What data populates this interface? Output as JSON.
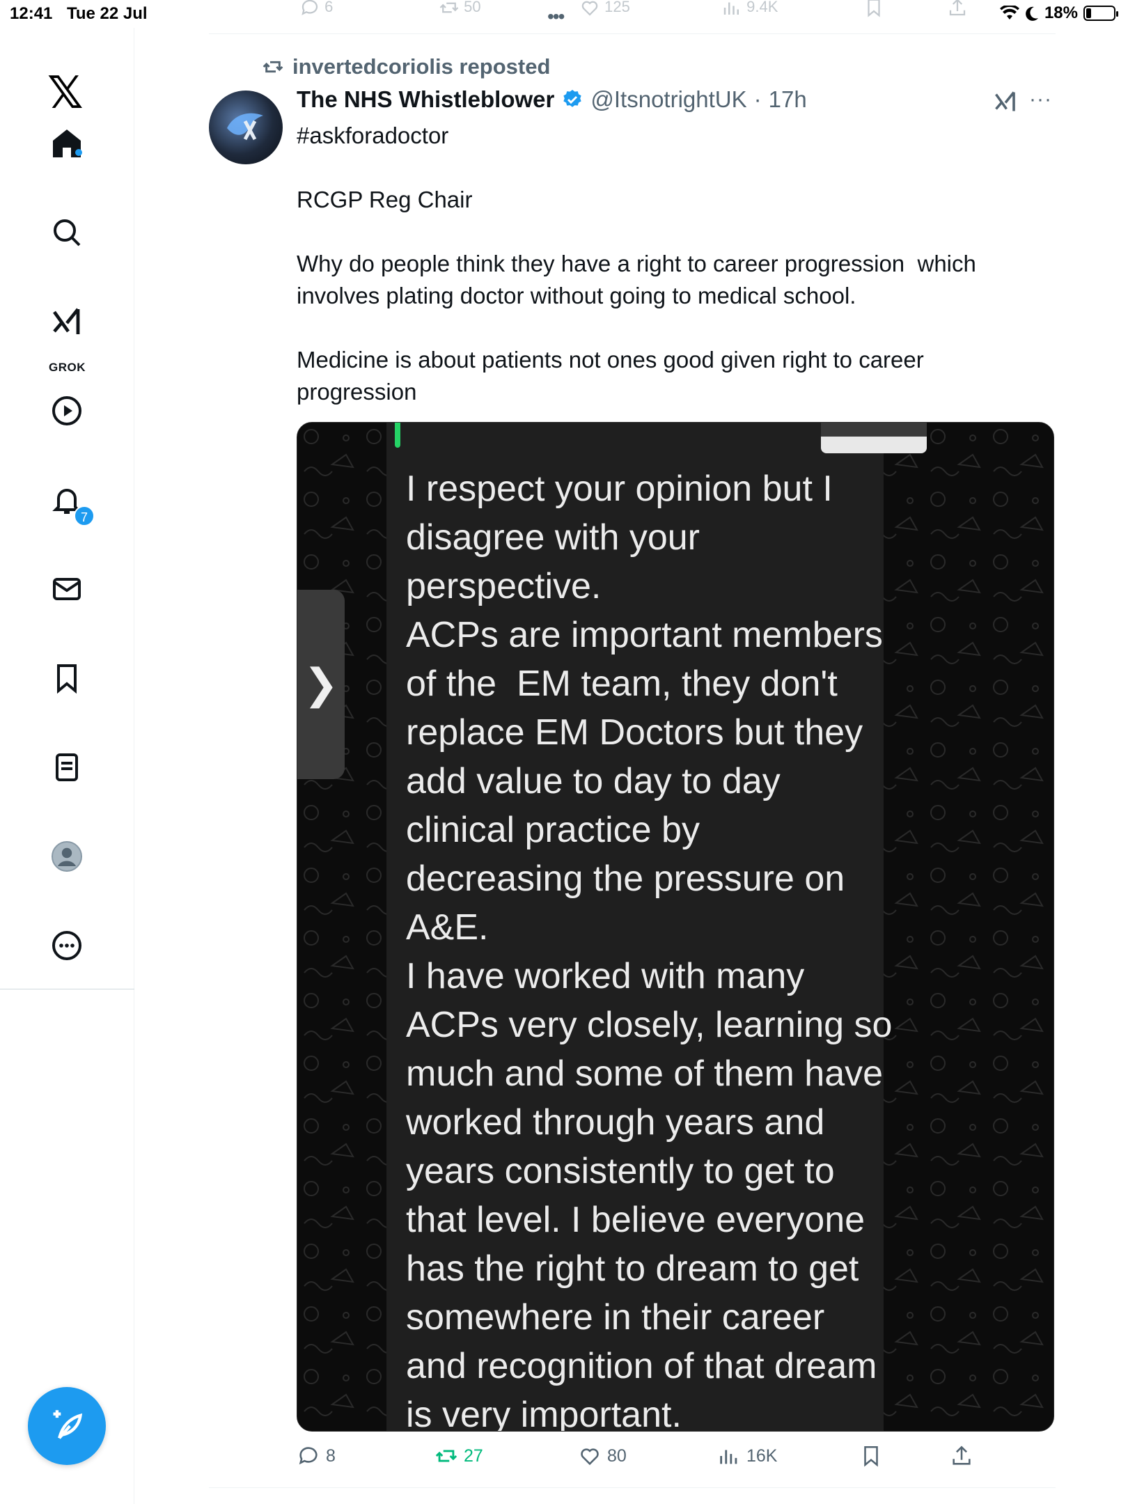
{
  "status_bar": {
    "time": "12:41",
    "date": "Tue 22 Jul",
    "battery_percent": "18%",
    "battery_level": 0.18
  },
  "previous_tweet": {
    "replies": "6",
    "reposts": "50",
    "likes": "125",
    "views": "9.4K"
  },
  "sidebar": {
    "grok_label": "GROK",
    "notification_badge": "7"
  },
  "tweet": {
    "reposted_by": "invertedcoriolis reposted",
    "author_name": "The NHS Whistleblower",
    "author_handle": "@ItsnotrightUK",
    "separator": "·",
    "time": "17h",
    "paragraphs": [
      "#askforadoctor",
      "RCGP Reg Chair",
      "Why do people think they have a right to career progression  which involves plating doctor without going to medical school.",
      "Medicine is about patients not ones good given right to career progression"
    ],
    "image_text": "I respect your opinion but I\ndisagree with your\nperspective.\nACPs are important members\nof the  EM team, they don't\nreplace EM Doctors but they\nadd value to day to day\nclinical practice by\ndecreasing the pressure on\nA&E.\nI have worked with many\nACPs very closely, learning so\nmuch and some of them have\nworked through years and\nyears consistently to get to\nthat level. I believe everyone\nhas the right to dream to get\nsomewhere in their career\nand recognition of that dream\nis very important.",
    "image_arrow": "❯",
    "stats": {
      "replies": "8",
      "reposts": "27",
      "likes": "80",
      "views": "16K"
    }
  },
  "colors": {
    "accent": "#1d9bf0",
    "repost_green": "#00ba7c",
    "secondary_text": "#536471",
    "whatsapp_green": "#25d366"
  }
}
